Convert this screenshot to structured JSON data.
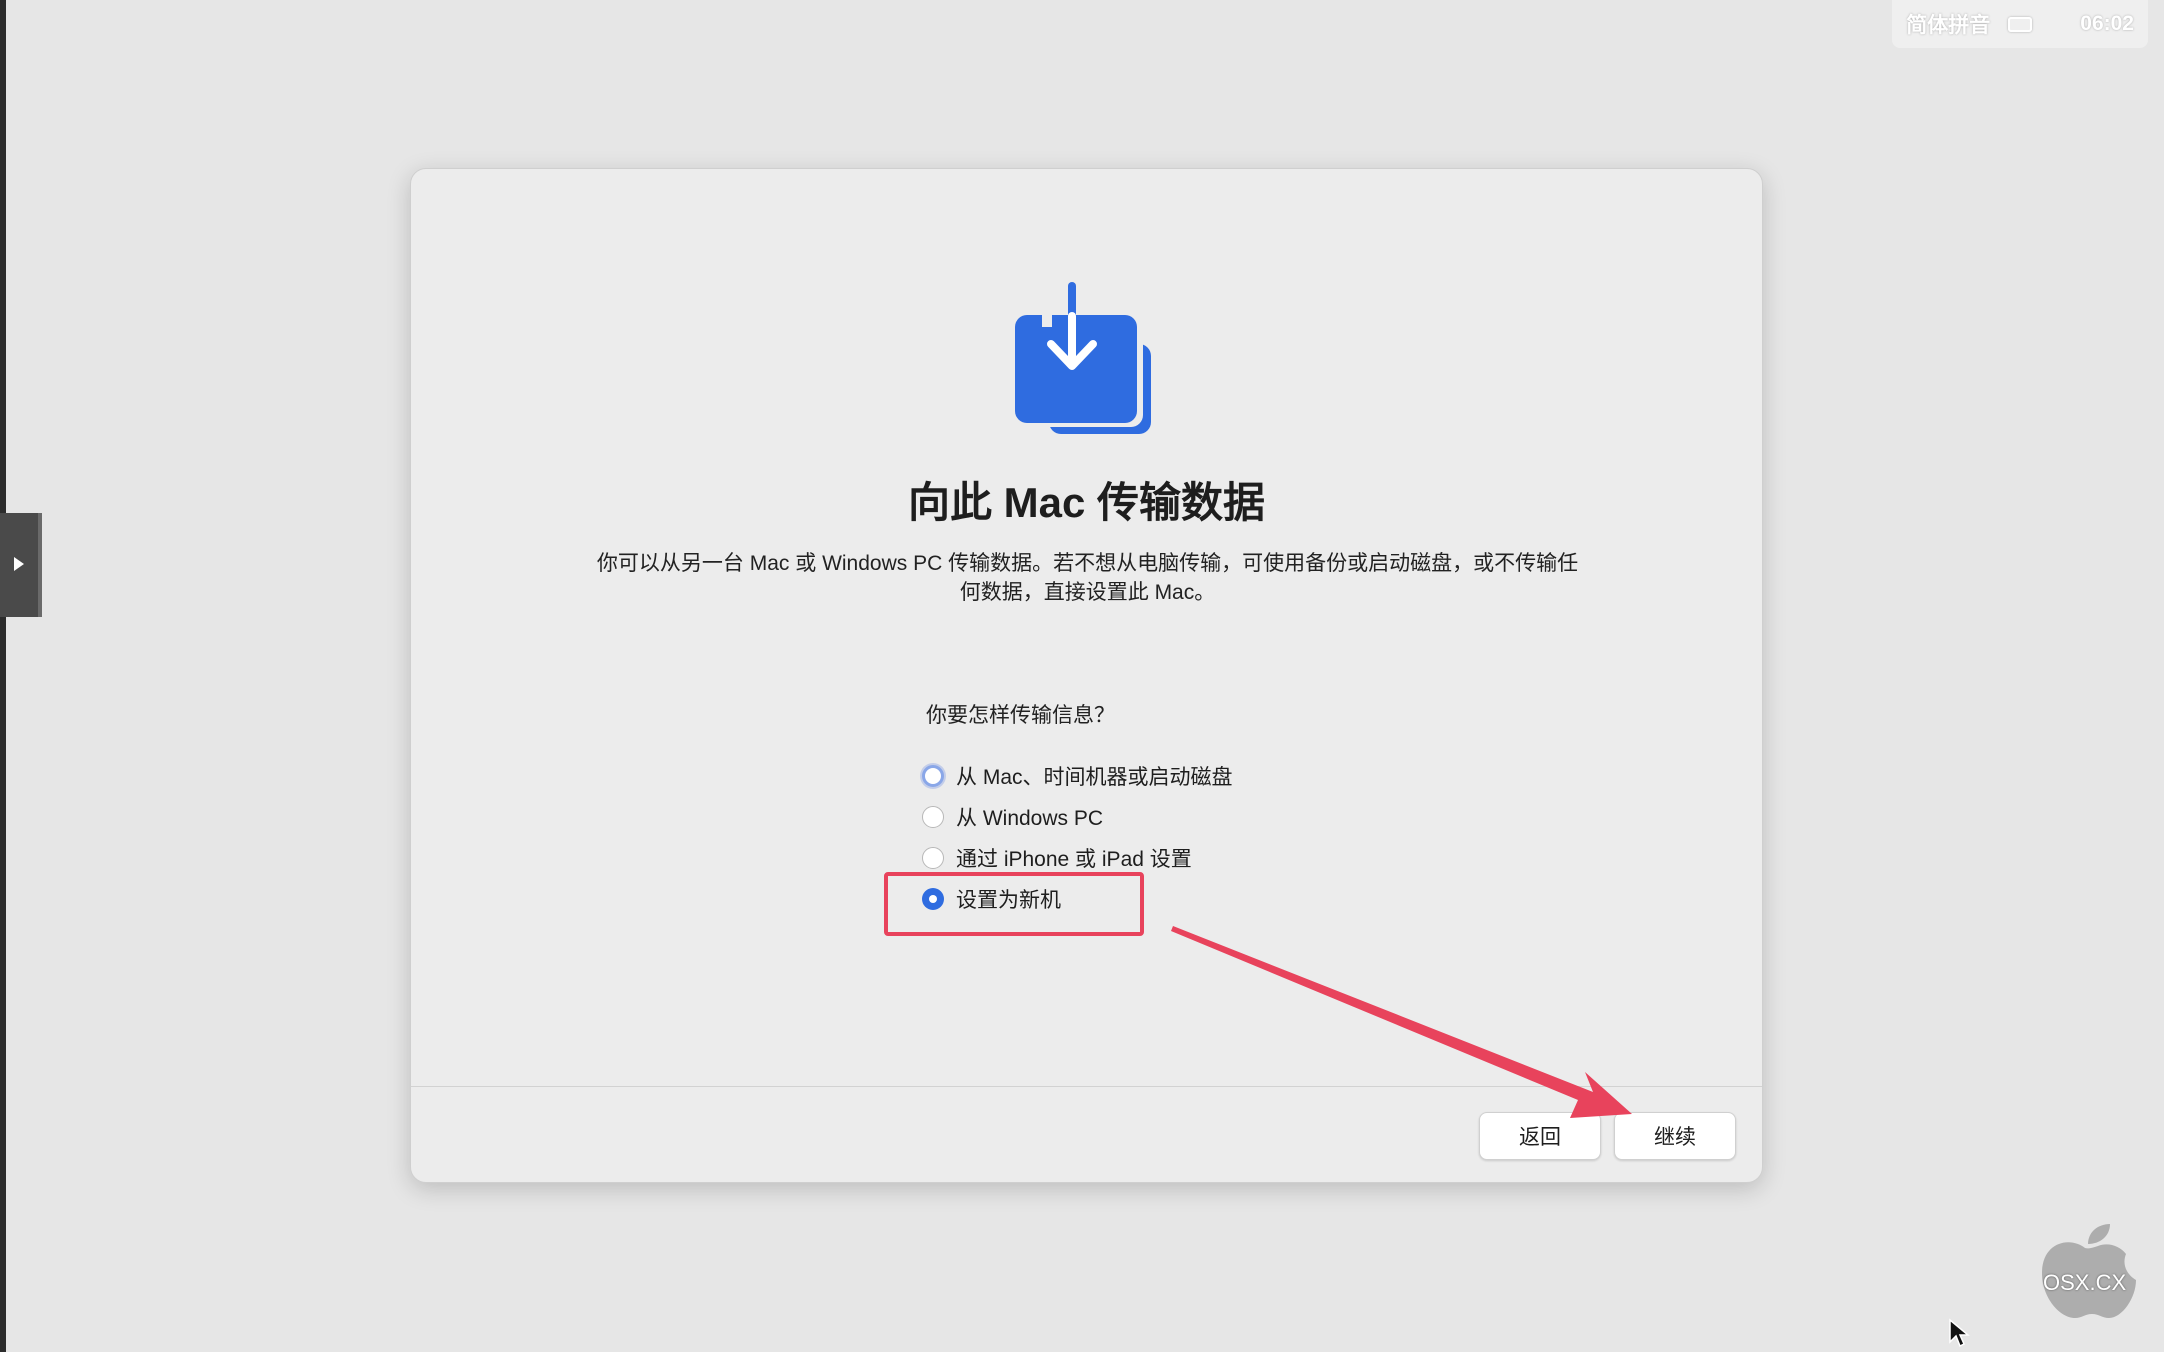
{
  "menubar": {
    "input_method": "简体拼音",
    "keyboard_icon": "keyboard-icon",
    "clock": "06:02"
  },
  "dialog": {
    "icon": "migration-download-icon",
    "accent_color": "#2f6ce0",
    "title": "向此 Mac 传输数据",
    "description": "你可以从另一台 Mac 或 Windows PC 传输数据。若不想从电脑传输，可使用备份或启动磁盘，或不传输任何数据，直接设置此 Mac。",
    "question": "你要怎样传输信息？",
    "options": [
      {
        "label": "从 Mac、时间机器或启动磁盘",
        "state": "focused"
      },
      {
        "label": "从 Windows PC",
        "state": "unchecked"
      },
      {
        "label": "通过 iPhone 或 iPad 设置",
        "state": "unchecked"
      },
      {
        "label": "设置为新机",
        "state": "checked"
      }
    ],
    "back_label": "返回",
    "continue_label": "继续"
  },
  "annotation": {
    "highlight_color": "#e8435c"
  },
  "watermark": {
    "text": "OSX.CX"
  }
}
